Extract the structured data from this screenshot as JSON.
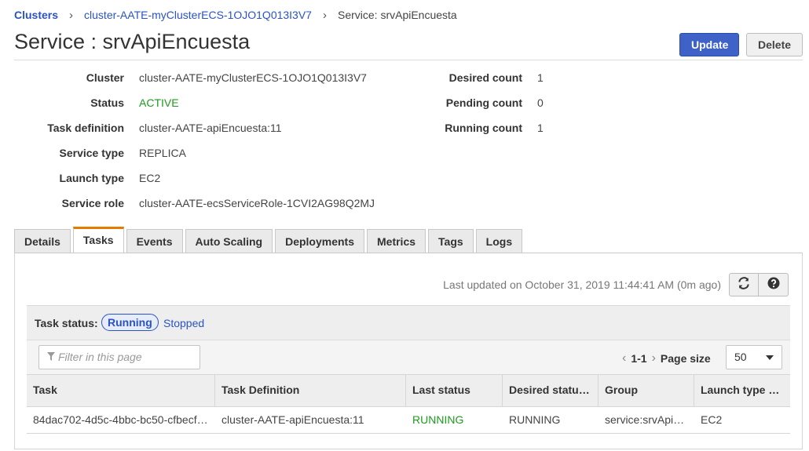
{
  "breadcrumb": {
    "root": "Clusters",
    "sep": "›",
    "cluster": "cluster-AATE-myClusterECS-1OJO1Q013I3V7",
    "current": "Service: srvApiEncuesta"
  },
  "title": "Service : srvApiEncuesta",
  "buttons": {
    "update": "Update",
    "delete": "Delete"
  },
  "details_left": [
    {
      "label": "Cluster",
      "value": "cluster-AATE-myClusterECS-1OJO1Q013I3V7"
    },
    {
      "label": "Status",
      "value": "ACTIVE"
    },
    {
      "label": "Task definition",
      "value": "cluster-AATE-apiEncuesta:11"
    },
    {
      "label": "Service type",
      "value": "REPLICA"
    },
    {
      "label": "Launch type",
      "value": "EC2"
    },
    {
      "label": "Service role",
      "value": "cluster-AATE-ecsServiceRole-1CVI2AG98Q2MJ"
    }
  ],
  "details_right": [
    {
      "label": "Desired count",
      "value": "1"
    },
    {
      "label": "Pending count",
      "value": "0"
    },
    {
      "label": "Running count",
      "value": "1"
    }
  ],
  "tabs": [
    "Details",
    "Tasks",
    "Events",
    "Auto Scaling",
    "Deployments",
    "Metrics",
    "Tags",
    "Logs"
  ],
  "selected_tab": "Tasks",
  "last_updated": "Last updated on October 31, 2019 11:44:41 AM (0m ago)",
  "task_status": {
    "label": "Task status:",
    "running": "Running",
    "stopped": "Stopped"
  },
  "filter": {
    "placeholder": "Filter in this page"
  },
  "pagination": {
    "range": "1-1",
    "page_size_label": "Page size",
    "page_size": "50"
  },
  "table": {
    "columns": [
      "Task",
      "Task Definition",
      "Last status",
      "Desired statu…",
      "Group",
      "Launch type …"
    ],
    "rows": [
      {
        "task": "84dac702-4d5c-4bbc-bc50-cfbecf…",
        "task_definition": "cluster-AATE-apiEncuesta:11",
        "last_status": "RUNNING",
        "desired_status": "RUNNING",
        "group": "service:srvApi…",
        "launch_type": "EC2"
      }
    ]
  },
  "colors": {
    "link": "#2a53c3",
    "active": "#1d9b1d",
    "primary": "#3f62c9",
    "tab_accent": "#e47a00"
  },
  "icons": {
    "refresh": "refresh-icon",
    "help": "help-icon",
    "filter": "filter-icon"
  }
}
